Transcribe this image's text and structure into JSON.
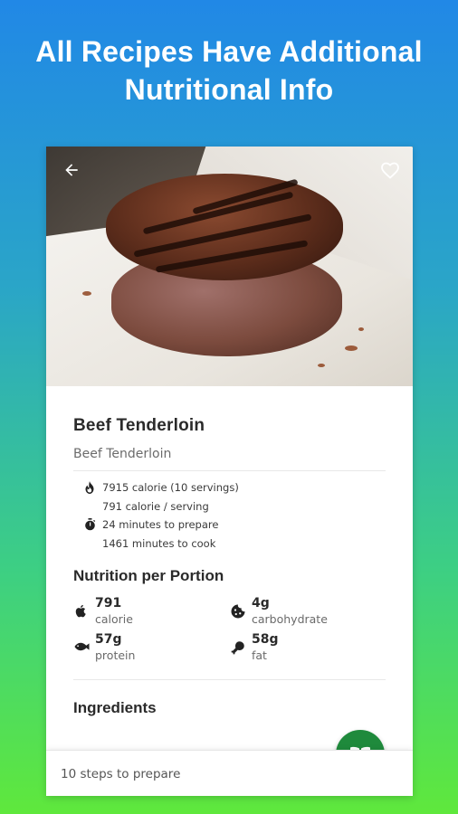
{
  "headline": {
    "line1": "All Recipes Have Additional",
    "line2": "Nutritional Info"
  },
  "recipe": {
    "title": "Beef Tenderloin",
    "subtitle": "Beef Tenderloin",
    "stats": {
      "total_calories": "7915 calorie (10 servings)",
      "per_serving": "791 calorie / serving",
      "prep_time": "24 minutes to prepare",
      "cook_time": "1461 minutes to cook"
    }
  },
  "nutrition": {
    "heading": "Nutrition per Portion",
    "items": [
      {
        "value": "791",
        "label": "calorie",
        "icon": "apple-icon"
      },
      {
        "value": "4g",
        "label": "carbohydrate",
        "icon": "cookie-icon"
      },
      {
        "value": "57g",
        "label": "protein",
        "icon": "fish-icon"
      },
      {
        "value": "58g",
        "label": "fat",
        "icon": "meat-icon"
      }
    ]
  },
  "ingredients": {
    "heading": "Ingredients"
  },
  "bottom_bar": {
    "steps_text": "10 steps to prepare"
  },
  "colors": {
    "fab": "#1f8a3c",
    "gradient_top": "#2188e6",
    "gradient_bottom": "#5fe83c"
  },
  "icons": {
    "back": "back-arrow-icon",
    "favorite": "heart-outline-icon",
    "fab": "book-open-icon",
    "calories": "flame-icon",
    "time": "stopwatch-icon"
  }
}
